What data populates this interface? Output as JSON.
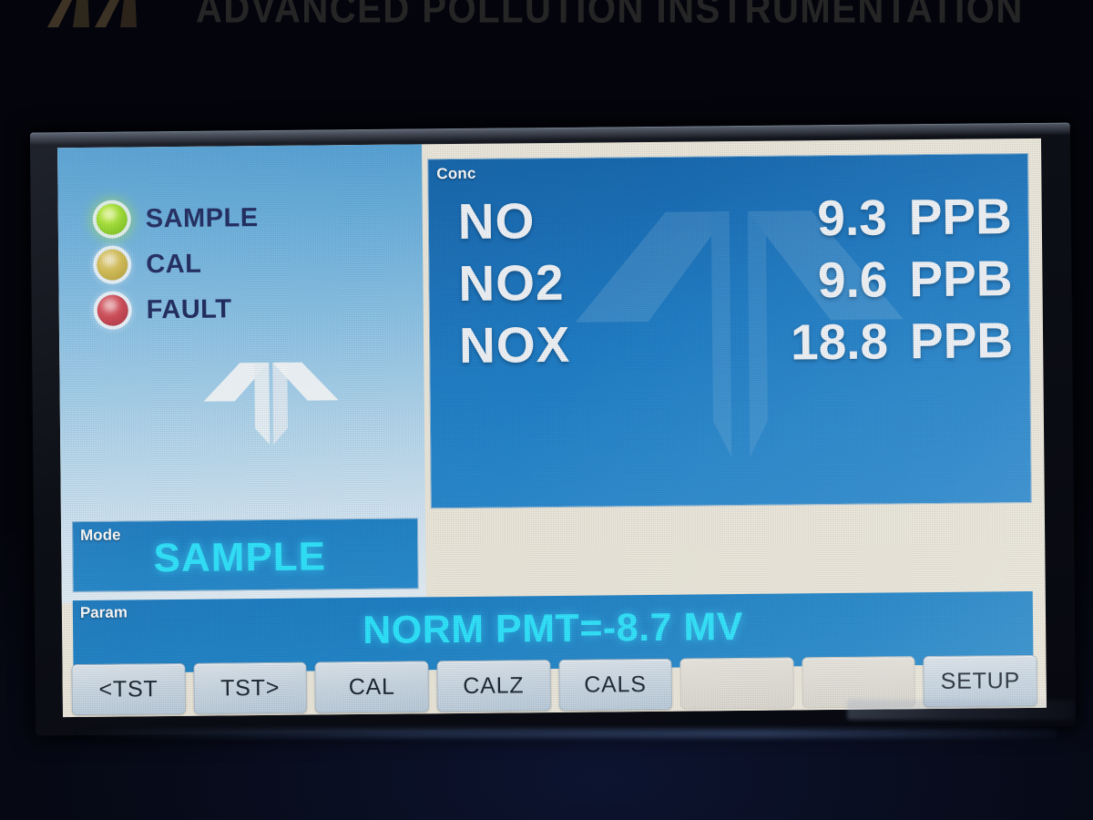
{
  "banner": {
    "title": "ADVANCED POLLUTION INSTRUMENTATION",
    "logo_icon": "teledyne-chevron-logo-icon",
    "logo_color": "#4a3c2a"
  },
  "display": {
    "status_panel": {
      "leds": [
        {
          "label": "SAMPLE",
          "state": "on",
          "color": "#9ee02a",
          "icon": "led-indicator-icon"
        },
        {
          "label": "CAL",
          "state": "off",
          "color": "#d4bc4e",
          "icon": "led-indicator-icon"
        },
        {
          "label": "FAULT",
          "state": "off",
          "color": "#cf4450",
          "icon": "led-indicator-icon"
        }
      ],
      "brand_mark_icon": "teledyne-t-mark-icon"
    },
    "conc_panel": {
      "caption": "Conc",
      "watermark_icon": "teledyne-t-watermark-icon",
      "readings": [
        {
          "gas": "NO",
          "value": "9.3",
          "unit": "PPB"
        },
        {
          "gas": "NO2",
          "value": "9.6",
          "unit": "PPB"
        },
        {
          "gas": "NOX",
          "value": "18.8",
          "unit": "PPB"
        }
      ]
    },
    "mode_panel": {
      "caption": "Mode",
      "value": "SAMPLE"
    },
    "param_panel": {
      "caption": "Param",
      "value": "NORM PMT=-8.7 MV"
    },
    "function_buttons": [
      {
        "label": "<TST",
        "enabled": true
      },
      {
        "label": "TST>",
        "enabled": true
      },
      {
        "label": "CAL",
        "enabled": true
      },
      {
        "label": "CALZ",
        "enabled": true
      },
      {
        "label": "CALS",
        "enabled": true
      },
      {
        "label": "",
        "enabled": false
      },
      {
        "label": "",
        "enabled": false
      },
      {
        "label": "SETUP",
        "enabled": true
      }
    ]
  },
  "theme": {
    "lcd_bg": "#eeeade",
    "panel_blue": "#2287cb",
    "conc_blue": "#1b72bb",
    "cyan_text": "#2fe6ff",
    "label_navy": "#19255c"
  }
}
